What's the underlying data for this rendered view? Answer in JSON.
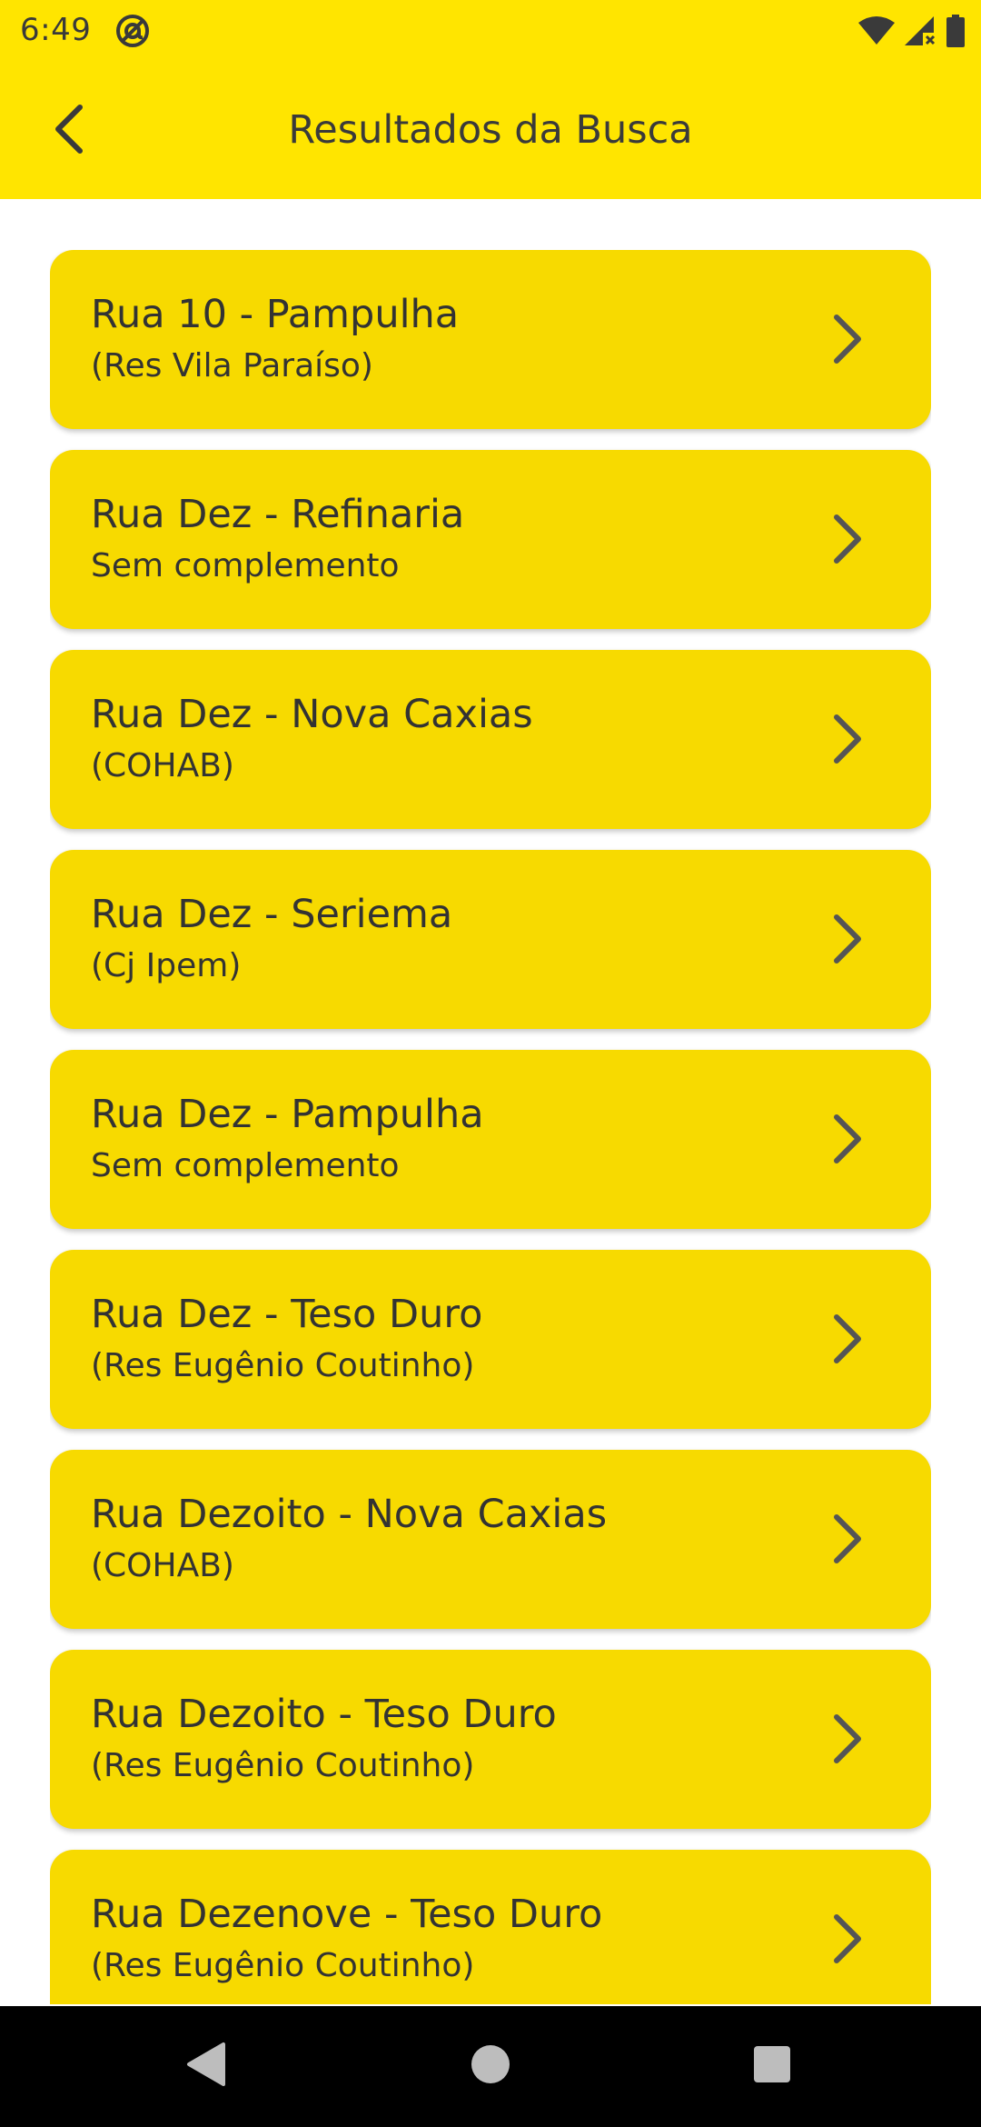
{
  "status_bar": {
    "time": "6:49",
    "left_icon": "at-sign-icon",
    "right_icons": [
      "wifi-icon",
      "signal-icon",
      "battery-icon"
    ]
  },
  "app_bar": {
    "title": "Resultados da Busca",
    "back_icon": "back-arrow-icon"
  },
  "results": [
    {
      "title": "Rua 10 - Pampulha",
      "subtitle": "(Res Vila Paraíso)"
    },
    {
      "title": "Rua Dez - Refinaria",
      "subtitle": "Sem complemento"
    },
    {
      "title": "Rua Dez - Nova Caxias",
      "subtitle": "(COHAB)"
    },
    {
      "title": "Rua Dez - Seriema",
      "subtitle": "(Cj Ipem)"
    },
    {
      "title": "Rua Dez - Pampulha",
      "subtitle": "Sem complemento"
    },
    {
      "title": "Rua Dez - Teso Duro",
      "subtitle": "(Res Eugênio Coutinho)"
    },
    {
      "title": "Rua Dezoito - Nova Caxias",
      "subtitle": "(COHAB)"
    },
    {
      "title": "Rua Dezoito - Teso Duro",
      "subtitle": "(Res Eugênio Coutinho)"
    },
    {
      "title": "Rua Dezenove - Teso Duro",
      "subtitle": "(Res Eugênio Coutinho)"
    }
  ],
  "nav_bar": {
    "buttons": [
      "back-triangle-icon",
      "home-circle-icon",
      "recents-square-icon"
    ]
  },
  "colors": {
    "header_yellow": "#FFE500",
    "card_yellow": "#F7DA00",
    "text_dark": "#333333",
    "nav_black": "#000000",
    "nav_icon_gray": "#BDBDBD"
  }
}
